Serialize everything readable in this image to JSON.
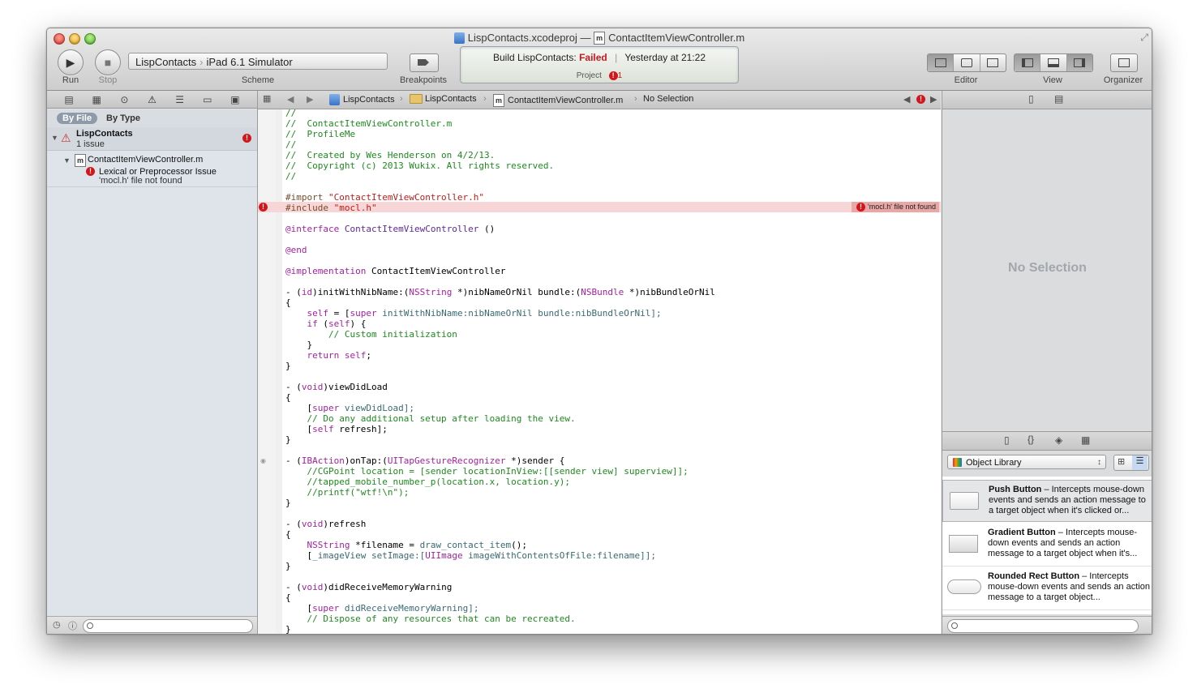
{
  "window": {
    "title_project": "LispContacts.xcodeproj",
    "title_dash": "—",
    "title_file": "ContactItemViewController.m"
  },
  "toolbar": {
    "run_label": "Run",
    "stop_label": "Stop",
    "scheme_target": "LispContacts",
    "scheme_destination": "iPad 6.1 Simulator",
    "scheme_label": "Scheme",
    "breakpoints_label": "Breakpoints",
    "editor_label": "Editor",
    "view_label": "View",
    "organizer_label": "Organizer"
  },
  "activity": {
    "build_text": "Build LispContacts:",
    "status": "Failed",
    "separator": "|",
    "time": "Yesterday at 21:22",
    "project_label": "Project",
    "issue_count": "1",
    "status_color": "#c8191d"
  },
  "navigator": {
    "tab_by_file": "By File",
    "tab_by_type": "By Type",
    "project_name": "LispContacts",
    "project_issues": "1 issue",
    "file_name": "ContactItemViewController.m",
    "issue_title": "Lexical or Preprocessor Issue",
    "issue_message": "'mocl.h' file not found",
    "error_glyph": "!"
  },
  "jumpbar": {
    "crumb_project": "LispContacts",
    "crumb_group": "LispContacts",
    "crumb_file": "ContactItemViewController.m",
    "crumb_selection": "No Selection"
  },
  "editor": {
    "error_tag": "'mocl.h' file not found",
    "code": {
      "l1": "//",
      "l2": "//  ContactItemViewController.m",
      "l3": "//  ProfileMe",
      "l4": "//",
      "l5": "//  Created by Wes Henderson on 4/2/13.",
      "l6": "//  Copyright (c) 2013 Wukix. All rights reserved.",
      "l7": "//",
      "import_kw": "#import ",
      "import_str": "\"ContactItemViewController.h\"",
      "include_kw": "#include ",
      "include_str": "\"mocl.h\"",
      "iface_kw": "@interface ",
      "iface_cls": "ContactItemViewController",
      "iface_rest": " ()",
      "end1": "@end",
      "impl_kw": "@implementation ",
      "impl_cls": "ContactItemViewController",
      "init_a": "- (",
      "init_id": "id",
      "init_b": ")initWithNibName:(",
      "init_ns1": "NSString",
      "init_c": " *)nibNameOrNil bundle:(",
      "init_ns2": "NSBundle",
      "init_d": " *)nibBundleOrNil",
      "brace_open": "{",
      "brace_close": "}",
      "self_a": "    ",
      "self_kw": "self",
      "self_b": " = [",
      "super_kw": "super",
      "self_c": " initWithNibName:nibNameOrNil bundle:nibBundleOrNil];",
      "if_a": "    ",
      "if_kw": "if",
      "if_b": " (",
      "if_self": "self",
      "if_c": ") {",
      "custom_init": "        // Custom initialization",
      "inner_close": "    }",
      "ret_a": "    ",
      "ret_kw": "return",
      "ret_b": " ",
      "ret_self": "self",
      "ret_c": ";",
      "vdl_a": "- (",
      "vdl_void": "void",
      "vdl_b": ")viewDidLoad",
      "vdl_super_a": "    [",
      "vdl_super_kw": "super",
      "vdl_super_b": " viewDidLoad];",
      "vdl_comment": "    // Do any additional setup after loading the view.",
      "vdl_refresh_a": "    [",
      "vdl_refresh_kw": "self",
      "vdl_refresh_b": " refresh];",
      "tap_a": "- (",
      "tap_ib": "IBAction",
      "tap_b": ")onTap:(",
      "tap_cls": "UITapGestureRecognizer",
      "tap_c": " *)sender {",
      "tap_c1": "    //CGPoint location = [sender locationInView:[[sender view] superview]];",
      "tap_c2": "    //tapped_mobile_number_p(location.x, location.y);",
      "tap_c3": "    //printf(\"wtf!\\n\");",
      "ref_a": "- (",
      "ref_void": "void",
      "ref_b": ")refresh",
      "ref_ns_a": "    ",
      "ref_ns": "NSString",
      "ref_ns_b": " *filename = ",
      "ref_fn": "draw_contact_item",
      "ref_ns_c": "();",
      "ref_img_a": "    [",
      "ref_img_iv": "_imageView",
      "ref_img_b": " setImage:[",
      "ref_img_cls": "UIImage",
      "ref_img_c": " imageWithContentsOfFile:filename]];",
      "mem_a": "- (",
      "mem_void": "void",
      "mem_b": ")didReceiveMemoryWarning",
      "mem_super_a": "    [",
      "mem_super_kw": "super",
      "mem_super_b": " didReceiveMemoryWarning];",
      "mem_comment": "    // Dispose of any resources that can be recreated."
    }
  },
  "inspector": {
    "no_selection": "No Selection",
    "library_select": "Object Library",
    "items": [
      {
        "name": "Push Button",
        "desc": " – Intercepts mouse-down events and sends an action message to a target object when it's clicked or..."
      },
      {
        "name": "Gradient Button",
        "desc": " – Intercepts mouse-down events and sends an action message to a target object when it's..."
      },
      {
        "name": "Rounded Rect Button",
        "desc": " – Intercepts mouse-down events and sends an action message to a target object..."
      }
    ]
  }
}
